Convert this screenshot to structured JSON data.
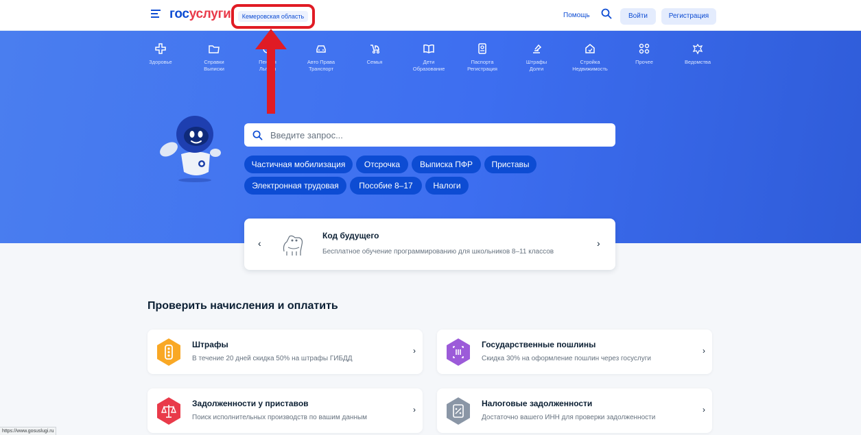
{
  "header": {
    "logo_part1": "гос",
    "logo_part2": "услуги",
    "region": "Кемеровская область",
    "help": "Помощь",
    "login": "Войти",
    "register": "Регистрация"
  },
  "categories": [
    {
      "line1": "Здоровье",
      "line2": "",
      "icon": "health-cross-icon"
    },
    {
      "line1": "Справки",
      "line2": "Выписки",
      "icon": "folder-icon"
    },
    {
      "line1": "Пенсия",
      "line2": "Льготы",
      "icon": "pension-icon"
    },
    {
      "line1": "Авто Права",
      "line2": "Транспорт",
      "icon": "car-icon"
    },
    {
      "line1": "Семья",
      "line2": "",
      "icon": "stroller-icon"
    },
    {
      "line1": "Дети",
      "line2": "Образование",
      "icon": "book-icon"
    },
    {
      "line1": "Паспорта",
      "line2": "Регистрация",
      "icon": "passport-icon"
    },
    {
      "line1": "Штрафы",
      "line2": "Долги",
      "icon": "gavel-icon"
    },
    {
      "line1": "Стройка",
      "line2": "Недвижимость",
      "icon": "house-icon"
    },
    {
      "line1": "Прочее",
      "line2": "",
      "icon": "grid-icon"
    },
    {
      "line1": "Ведомства",
      "line2": "",
      "icon": "emblem-icon"
    }
  ],
  "search": {
    "placeholder": "Введите запрос..."
  },
  "chips": [
    "Частичная мобилизация",
    "Отсрочка",
    "Выписка ПФР",
    "Приставы",
    "Электронная трудовая",
    "Пособие 8–17",
    "Налоги"
  ],
  "promo": {
    "title": "Код будущего",
    "subtitle": "Бесплатное обучение программированию для школьников 8–11 классов"
  },
  "section": {
    "title": "Проверить начисления и оплатить",
    "cards": [
      {
        "title": "Штрафы",
        "subtitle": "В течение 20 дней скидка 50% на штрафы ГИБДД",
        "icon": "traffic-light-icon",
        "color": "#f9a825"
      },
      {
        "title": "Государственные пошлины",
        "subtitle": "Скидка 30% на оформление пошлин через госуслуги",
        "icon": "receipt-icon",
        "color": "#9c5bd9"
      },
      {
        "title": "Задолженности у приставов",
        "subtitle": "Поиск исполнительных производств по вашим данным",
        "icon": "scales-icon",
        "color": "#e93a4a"
      },
      {
        "title": "Налоговые задолженности",
        "subtitle": "Достаточно вашего ИНН для проверки задолженности",
        "icon": "tax-document-icon",
        "color": "#8a96a6"
      }
    ]
  },
  "status_url": "https://www.gosuslugi.ru",
  "colors": {
    "brand_blue": "#0d4cd3",
    "brand_red": "#e93a4a",
    "annotation_red": "#e01b24"
  }
}
